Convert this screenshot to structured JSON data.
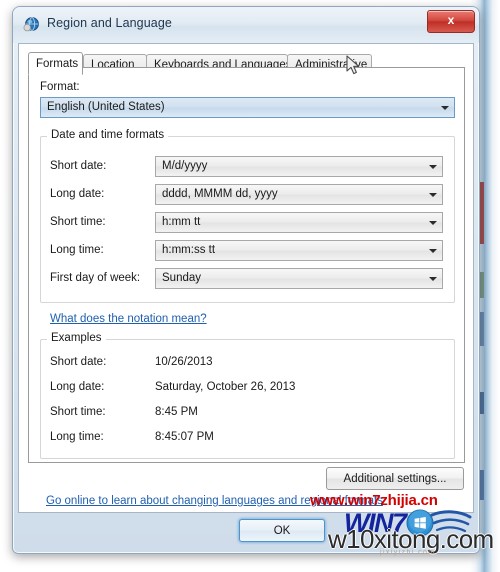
{
  "window": {
    "title": "Region and Language",
    "icon": "globe-icon",
    "close_label": "x"
  },
  "tabs": [
    {
      "label": "Formats",
      "active": true
    },
    {
      "label": "Location",
      "active": false
    },
    {
      "label": "Keyboards and Languages",
      "active": false
    },
    {
      "label": "Administrative",
      "active": false
    }
  ],
  "format_section": {
    "label": "Format:",
    "value": "English (United States)"
  },
  "date_time_formats": {
    "group_title": "Date and time formats",
    "rows": [
      {
        "label": "Short date:",
        "value": "M/d/yyyy"
      },
      {
        "label": "Long date:",
        "value": "dddd, MMMM dd, yyyy"
      },
      {
        "label": "Short time:",
        "value": "h:mm tt"
      },
      {
        "label": "Long time:",
        "value": "h:mm:ss tt"
      },
      {
        "label": "First day of week:",
        "value": "Sunday"
      }
    ],
    "notation_link": "What does the notation mean?"
  },
  "examples": {
    "group_title": "Examples",
    "rows": [
      {
        "label": "Short date:",
        "value": "10/26/2013"
      },
      {
        "label": "Long date:",
        "value": "Saturday, October 26, 2013"
      },
      {
        "label": "Short time:",
        "value": "8:45 PM"
      },
      {
        "label": "Long time:",
        "value": "8:45:07 PM"
      }
    ]
  },
  "buttons": {
    "additional_settings": "Additional settings...",
    "ok": "OK"
  },
  "footer_link": "Go online to learn about changing languages and regional formats",
  "watermarks": {
    "red_site": "www.win7zhijia.cn",
    "logo_text": "WIN7",
    "bottom_site": "w10xitong.com",
    "faint_sub": "jixiyizhi.com"
  },
  "colors": {
    "accent_link": "#1f5fb0",
    "watermark_red": "#d40000",
    "watermark_blue": "#13249c",
    "close_button": "#c9362c",
    "titlebar": "#e2ebf3"
  }
}
